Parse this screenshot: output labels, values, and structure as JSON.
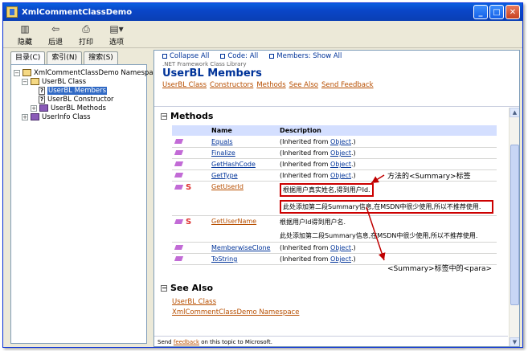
{
  "window": {
    "title": "XmlCommentClassDemo"
  },
  "toolbar": {
    "buttons": [
      {
        "label": "隐藏",
        "icon": "hide-icon"
      },
      {
        "label": "后退",
        "icon": "back-arrow-icon"
      },
      {
        "label": "打印",
        "icon": "printer-icon"
      },
      {
        "label": "选项",
        "icon": "options-icon"
      }
    ]
  },
  "tabs": [
    {
      "label": "目录(C)"
    },
    {
      "label": "索引(N)"
    },
    {
      "label": "搜索(S)"
    }
  ],
  "tree": {
    "root": "XmlCommentClassDemo Namespace",
    "class": "UserBL Class",
    "members": "UserBL Members",
    "constructor": "UserBL Constructor",
    "methods": "UserBL Methods",
    "userinfo": "UserInfo Class"
  },
  "header": {
    "collapse_all": "Collapse All",
    "code_all": "Code: All",
    "members_show": "Members: Show All",
    "library": ".NET Framework Class Library",
    "title": "UserBL Members",
    "links": [
      "UserBL Class",
      "Constructors",
      "Methods",
      "See Also",
      "Send Feedback"
    ]
  },
  "methods": {
    "heading": "Methods",
    "col_name": "Name",
    "col_desc": "Description",
    "rows": [
      {
        "name": "Equals",
        "desc_pre": "(Inherited from ",
        "desc_link": "Object",
        "desc_post": ".)"
      },
      {
        "name": "Finalize",
        "desc_pre": "(Inherited from ",
        "desc_link": "Object",
        "desc_post": ".)"
      },
      {
        "name": "GetHashCode",
        "desc_pre": "(Inherited from ",
        "desc_link": "Object",
        "desc_post": ".)"
      },
      {
        "name": "GetType",
        "desc_pre": "(Inherited from ",
        "desc_link": "Object",
        "desc_post": ".)"
      },
      {
        "name": "GetUserId",
        "desc1": "根据用户真实姓名,得到用户Id.",
        "desc2": "此处添加第二段Summary信息,在MSDN中很少使用,所以不推荐使用."
      },
      {
        "name": "GetUserName",
        "desc1": "根据用户Id得到用户名.",
        "desc2": "此处添加第二段Summary信息,在MSDN中很少使用,所以不推荐使用."
      },
      {
        "name": "MemberwiseClone",
        "desc_pre": "(Inherited from ",
        "desc_link": "Object",
        "desc_post": ".)"
      },
      {
        "name": "ToString",
        "desc_pre": "(Inherited from ",
        "desc_link": "Object",
        "desc_post": ".)"
      }
    ]
  },
  "see_also": {
    "heading": "See Also",
    "links": [
      "UserBL Class",
      "XmlCommentClassDemo Namespace"
    ]
  },
  "footer": {
    "pre": "Send ",
    "link": "feedback",
    "post": " on this topic to Microsoft."
  },
  "annotations": {
    "summary": "方法的<Summary>标签",
    "para": "<Summary>标签中的<para>"
  },
  "colors": {
    "accent": "#c00000",
    "link": "#003399",
    "orange_link": "#b74e00"
  }
}
